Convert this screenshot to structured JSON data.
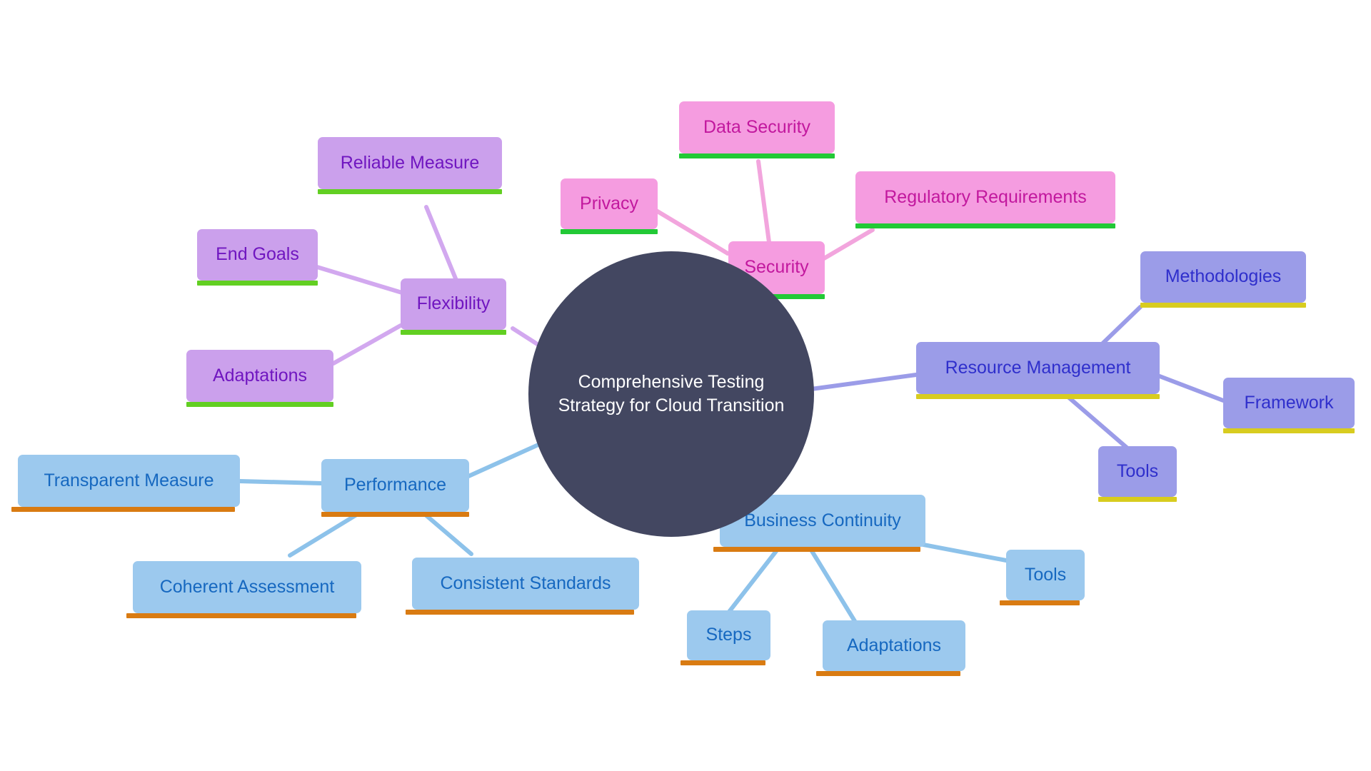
{
  "diagram": {
    "type": "mind-map",
    "background": "#ffffff",
    "root": {
      "label": "Comprehensive Testing Strategy for Cloud Transition",
      "line1": "Comprehensive Testing",
      "line2": "Strategy for Cloud Transition",
      "fill": "#434761",
      "text_color": "#ffffff",
      "shape": "ellipse"
    },
    "branches": [
      {
        "id": "security",
        "label": "Security",
        "theme": "pink",
        "fill": "#f59ce0",
        "text_color": "#c2189e",
        "accent": "#22c936",
        "children": [
          {
            "id": "data-security",
            "label": "Data Security"
          },
          {
            "id": "privacy",
            "label": "Privacy"
          },
          {
            "id": "regulatory-requirements",
            "label": "Regulatory Requirements"
          }
        ]
      },
      {
        "id": "flexibility",
        "label": "Flexibility",
        "theme": "purple",
        "fill": "#cba0ec",
        "text_color": "#7016c0",
        "accent": "#62cf22",
        "children": [
          {
            "id": "reliable-measure",
            "label": "Reliable Measure"
          },
          {
            "id": "end-goals",
            "label": "End Goals"
          },
          {
            "id": "adaptations-flexibility",
            "label": "Adaptations"
          }
        ]
      },
      {
        "id": "resource-management",
        "label": "Resource Management",
        "theme": "periwinkle",
        "fill": "#9b9ce8",
        "text_color": "#2f2fcc",
        "accent": "#d8cc1f",
        "children": [
          {
            "id": "methodologies",
            "label": "Methodologies"
          },
          {
            "id": "framework",
            "label": "Framework"
          },
          {
            "id": "tools-resource",
            "label": "Tools"
          }
        ]
      },
      {
        "id": "performance",
        "label": "Performance",
        "theme": "blue",
        "fill": "#9cc9ee",
        "text_color": "#1668c0",
        "accent": "#d97b12",
        "children": [
          {
            "id": "transparent-measure",
            "label": "Transparent Measure"
          },
          {
            "id": "coherent-assessment",
            "label": "Coherent Assessment"
          },
          {
            "id": "consistent-standards",
            "label": "Consistent Standards"
          }
        ]
      },
      {
        "id": "business-continuity",
        "label": "Business Continuity",
        "theme": "blue",
        "fill": "#9cc9ee",
        "text_color": "#1668c0",
        "accent": "#d97b12",
        "children": [
          {
            "id": "steps",
            "label": "Steps"
          },
          {
            "id": "adaptations-continuity",
            "label": "Adaptations"
          },
          {
            "id": "tools-continuity",
            "label": "Tools"
          }
        ]
      }
    ]
  }
}
